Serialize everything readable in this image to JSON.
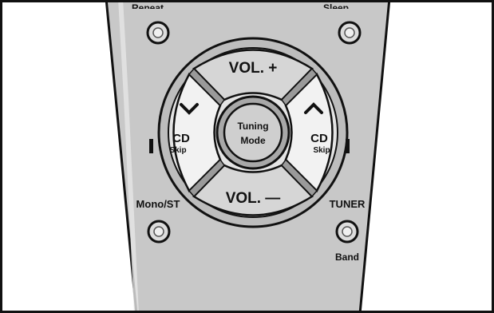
{
  "top_labels": {
    "left_cut": "Repeat",
    "right_cut": "Sleep"
  },
  "dpad": {
    "up": "VOL. +",
    "down": "VOL. —",
    "left_cd": "CD",
    "left_sub": "Skip",
    "right_cd": "CD",
    "right_sub": "Skip",
    "center_line1": "Tuning",
    "center_line2": "Mode",
    "left_arrow_icon": "chevron-down-icon",
    "right_arrow_icon": "chevron-up-icon"
  },
  "buttons": {
    "mono_st": "Mono/ST",
    "tuner": "TUNER",
    "band": "Band"
  },
  "colors": {
    "remote_body": "#c9c9c9",
    "button_face": "#d9d9d9",
    "outline": "#111111"
  }
}
